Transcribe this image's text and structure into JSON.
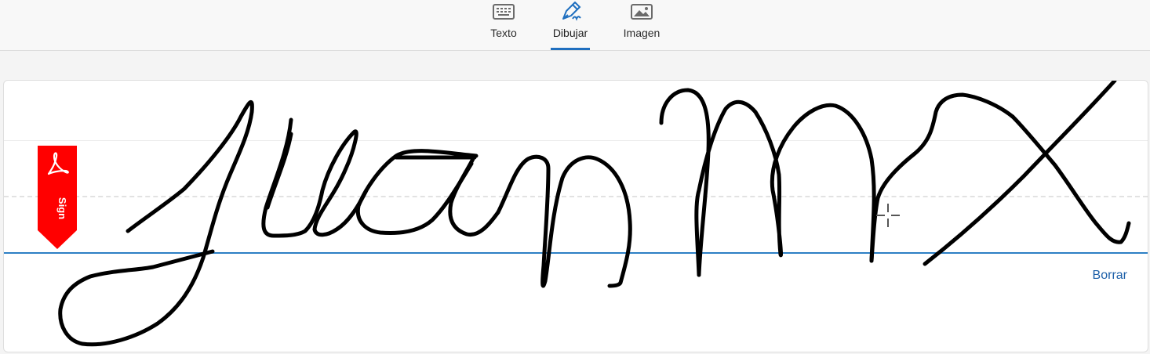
{
  "tabs": [
    {
      "label": "Texto",
      "icon": "keyboard-icon",
      "active": false
    },
    {
      "label": "Dibujar",
      "icon": "pen-icon",
      "active": true
    },
    {
      "label": "Imagen",
      "icon": "image-icon",
      "active": false
    }
  ],
  "canvas": {
    "sign_flag_text": "Sign",
    "clear_label": "Borrar",
    "baseline_color": "#2d7fc4",
    "flag_color": "#ff0000",
    "accent_color": "#1f6fbf"
  }
}
